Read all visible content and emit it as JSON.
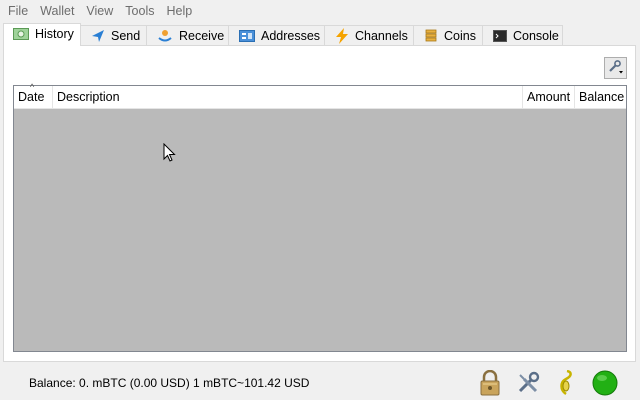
{
  "menu": [
    "File",
    "Wallet",
    "View",
    "Tools",
    "Help"
  ],
  "tabs": [
    {
      "label": "History",
      "icon": "history-icon",
      "active": true
    },
    {
      "label": "Send",
      "icon": "send-icon",
      "active": false
    },
    {
      "label": "Receive",
      "icon": "receive-icon",
      "active": false
    },
    {
      "label": "Addresses",
      "icon": "addresses-icon",
      "active": false
    },
    {
      "label": "Channels",
      "icon": "lightning-icon",
      "active": false
    },
    {
      "label": "Coins",
      "icon": "coins-icon",
      "active": false
    },
    {
      "label": "Console",
      "icon": "console-icon",
      "active": false
    }
  ],
  "table": {
    "columns": [
      "Date",
      "Description",
      "Amount",
      "Balance"
    ],
    "sort_column": "Date"
  },
  "status": {
    "balance": "Balance: 0. mBTC (0.00 USD)  1 mBTC~101.42 USD"
  },
  "colors": {
    "table_bg": "#bababa",
    "status_online": "#22b014",
    "lightning": "#f5a300"
  }
}
